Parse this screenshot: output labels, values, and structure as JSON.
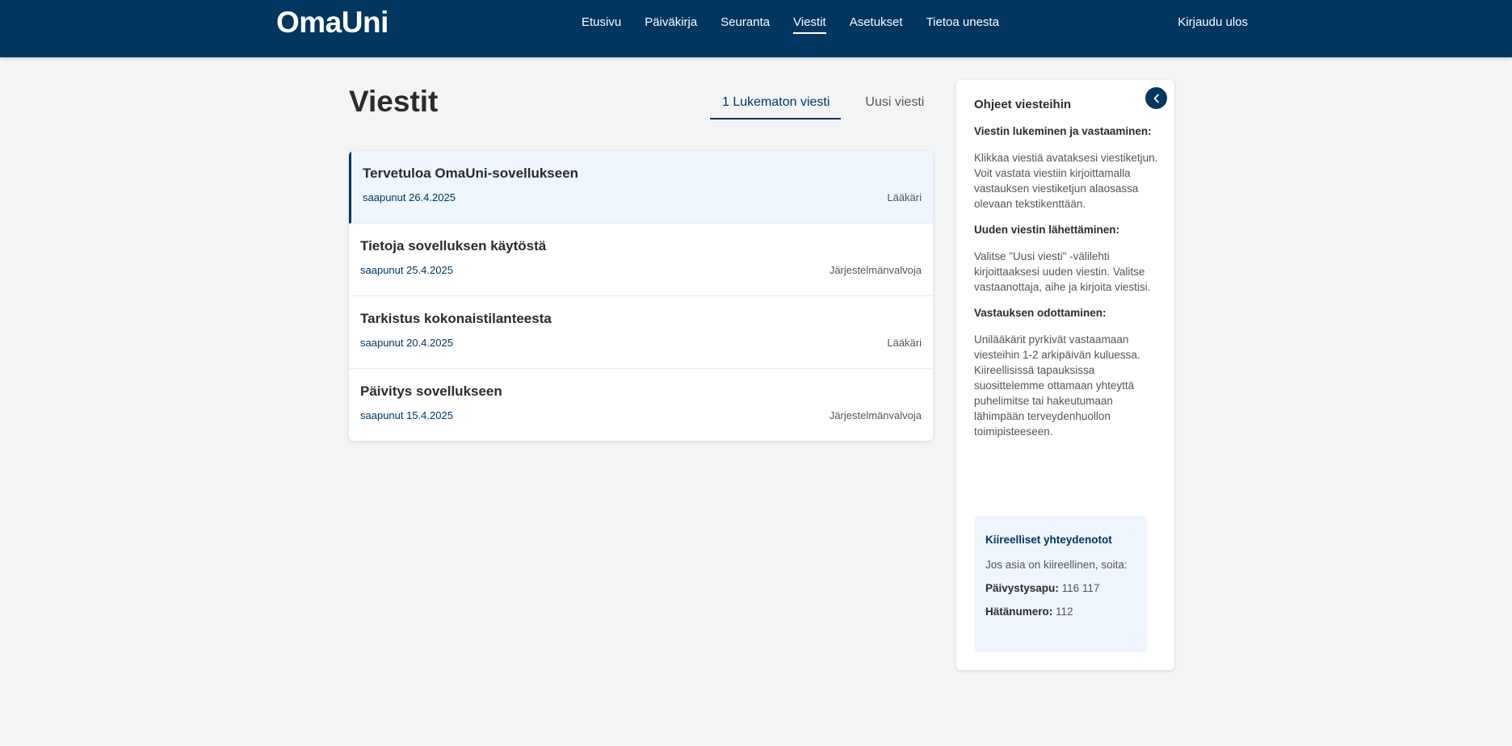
{
  "header": {
    "logo": "OmaUni",
    "nav": [
      {
        "label": "Etusivu"
      },
      {
        "label": "Päiväkirja"
      },
      {
        "label": "Seuranta"
      },
      {
        "label": "Viestit"
      },
      {
        "label": "Asetukset"
      },
      {
        "label": "Tietoa unesta"
      }
    ],
    "active_nav": "Viestit",
    "logout": "Kirjaudu ulos"
  },
  "main": {
    "title": "Viestit",
    "tabs": [
      {
        "label": "1 Lukematon viesti"
      },
      {
        "label": "Uusi viesti"
      }
    ],
    "messages": [
      {
        "title": "Tervetuloa OmaUni-sovellukseen",
        "date": "saapunut 26.4.2025",
        "sender": "Lääkäri",
        "unread": true
      },
      {
        "title": "Tietoja sovelluksen käytöstä",
        "date": "saapunut 25.4.2025",
        "sender": "Järjestelmänvalvoja",
        "unread": false
      },
      {
        "title": "Tarkistus kokonaistilanteesta",
        "date": "saapunut 20.4.2025",
        "sender": "Lääkäri",
        "unread": false
      },
      {
        "title": "Päivitys sovellukseen",
        "date": "saapunut 15.4.2025",
        "sender": "Järjestelmänvalvoja",
        "unread": false
      }
    ]
  },
  "help": {
    "title": "Ohjeet viesteihin",
    "sections": [
      {
        "heading": "Viestin lukeminen ja vastaaminen:",
        "text": "Klikkaa viestiä avataksesi viestiketjun. Voit vastata viestiin kirjoittamalla vastauksen viestiketjun alaosassa olevaan tekstikenttään."
      },
      {
        "heading": "Uuden viestin lähettäminen:",
        "text": "Valitse \"Uusi viesti\" -välilehti kirjoittaaksesi uuden viestin. Valitse vastaanottaja, aihe ja kirjoita viestisi."
      },
      {
        "heading": "Vastauksen odottaminen:",
        "text": "Unilääkärit pyrkivät vastaamaan viesteihin 1-2 arkipäivän kuluessa. Kiireellisissä tapauksissa suosittelemme ottamaan yhteyttä puhelimitse tai hakeutumaan lähimpään terveydenhuollon toimipisteeseen."
      }
    ],
    "urgent": {
      "title": "Kiireelliset yhteydenotot",
      "intro": "Jos asia on kiireellinen, soita:",
      "line1_label": "Päivystysapu:",
      "line1_value": "116 117",
      "line2_label": "Hätänumero:",
      "line2_value": "112"
    }
  },
  "colors": {
    "primary": "#003660",
    "unread_bg": "#eff6fd",
    "page_bg": "#f3f4f6"
  },
  "icons": {
    "collapse": "chevron-left-icon"
  }
}
